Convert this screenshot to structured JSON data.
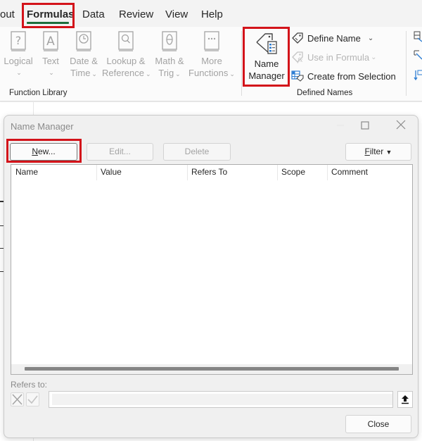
{
  "ribbon": {
    "tabs": [
      {
        "label": "out",
        "active": false
      },
      {
        "label": "Formulas",
        "active": true
      },
      {
        "label": "Data",
        "active": false
      },
      {
        "label": "Review",
        "active": false
      },
      {
        "label": "View",
        "active": false
      },
      {
        "label": "Help",
        "active": false
      }
    ],
    "function_library": {
      "label": "Function Library",
      "buttons": [
        {
          "line1": "Logical",
          "line2": "",
          "icon": "question-book-icon",
          "enabled": false
        },
        {
          "line1": "Text",
          "line2": "",
          "icon": "letter-a-book-icon",
          "enabled": false
        },
        {
          "line1": "Date &",
          "line2": "Time",
          "icon": "clock-book-icon",
          "enabled": false
        },
        {
          "line1": "Lookup &",
          "line2": "Reference",
          "icon": "magnifier-book-icon",
          "enabled": false
        },
        {
          "line1": "Math &",
          "line2": "Trig",
          "icon": "theta-book-icon",
          "enabled": false
        },
        {
          "line1": "More",
          "line2": "Functions",
          "icon": "ellipsis-book-icon",
          "enabled": false
        }
      ]
    },
    "defined_names": {
      "label": "Defined Names",
      "name_manager": {
        "line1": "Name",
        "line2": "Manager",
        "icon": "name-tag-list-icon"
      },
      "commands": [
        {
          "label": "Define Name",
          "icon": "tag-icon",
          "enabled": true,
          "has_dropdown": true
        },
        {
          "label": "Use in Formula",
          "icon": "tag-formula-icon",
          "enabled": false,
          "has_dropdown": true
        },
        {
          "label": "Create from Selection",
          "icon": "grid-tag-icon",
          "enabled": true,
          "has_dropdown": false
        }
      ]
    }
  },
  "dialog": {
    "title": "Name Manager",
    "buttons": {
      "new": "New...",
      "new_mnemonic": "N",
      "new_rest": "ew...",
      "edit": "Edit...",
      "delete": "Delete",
      "filter": "Filter",
      "filter_mnemonic": "F",
      "filter_rest": "ilter",
      "close": "Close"
    },
    "columns": [
      "Name",
      "Value",
      "Refers To",
      "Scope",
      "Comment"
    ],
    "rows": [],
    "refers_to": {
      "label": "Refers to:",
      "value": ""
    }
  },
  "highlights": {
    "color": "#d3131a",
    "targets": [
      "Formulas tab",
      "Name Manager button",
      "New... button"
    ]
  },
  "colors": {
    "accent_underline": "#1e6e3c",
    "disabled_text": "#a3a3a3"
  }
}
